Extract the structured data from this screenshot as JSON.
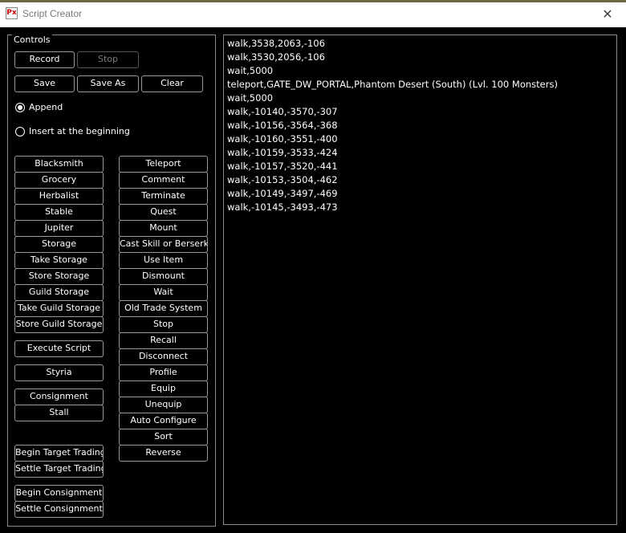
{
  "window": {
    "title": "Script Creator",
    "icon_text": "Px",
    "close_symbol": "✕"
  },
  "controls": {
    "legend": "Controls",
    "record": "Record",
    "stop": "Stop",
    "save": "Save",
    "save_as": "Save As",
    "clear": "Clear",
    "append_label": "Append",
    "insert_label": "Insert at the beginning",
    "left_buttons": [
      "Blacksmith",
      "Grocery",
      "Herbalist",
      "Stable",
      "Jupiter",
      "Storage",
      "Take Storage",
      "Store Storage",
      "Guild Storage",
      "Take Guild Storage",
      "Store Guild Storage"
    ],
    "execute_script": "Execute Script",
    "styria": "Styria",
    "consignment": "Consignment",
    "stall": "Stall",
    "begin_target_trading": "Begin Target Trading",
    "settle_target_trading": "Settle Target Trading",
    "begin_consignment": "Begin Consignment",
    "settle_consignment": "Settle Consignment",
    "right_buttons": [
      "Teleport",
      "Comment",
      "Terminate",
      "Quest",
      "Mount",
      "Cast Skill or Berserk",
      "Use Item",
      "Dismount",
      "Wait",
      "Old Trade System",
      "Stop",
      "Recall",
      "Disconnect",
      "Profile",
      "Equip",
      "Unequip",
      "Auto Configure",
      "Sort",
      "Reverse"
    ]
  },
  "script_lines": [
    "walk,3538,2063,-106",
    "walk,3530,2056,-106",
    "wait,5000",
    "teleport,GATE_DW_PORTAL,Phantom Desert (South) (Lvl. 100 Monsters)",
    "wait,5000",
    "walk,-10140,-3570,-307",
    "walk,-10156,-3564,-368",
    "walk,-10160,-3551,-400",
    "walk,-10159,-3533,-424",
    "walk,-10157,-3520,-441",
    "walk,-10153,-3504,-462",
    "walk,-10149,-3497,-469",
    "walk,-10145,-3493,-473"
  ]
}
